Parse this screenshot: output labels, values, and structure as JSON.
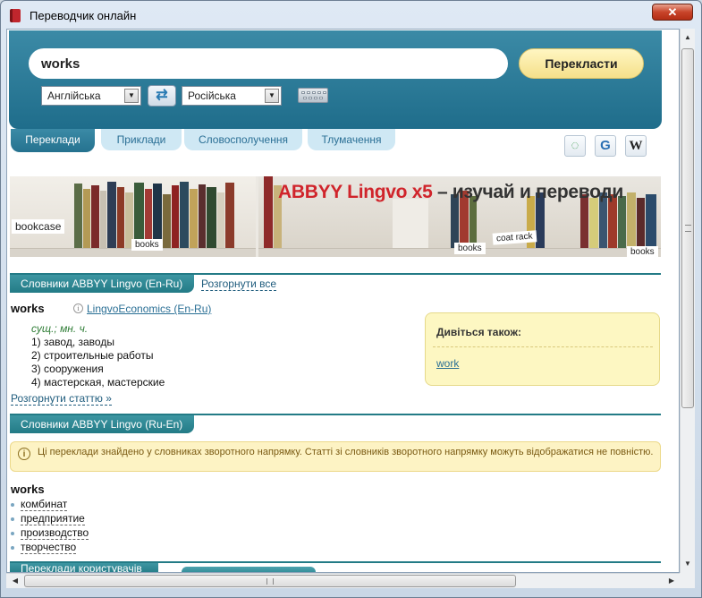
{
  "window": {
    "title": "Переводчик онлайн",
    "close_label": "✕"
  },
  "search": {
    "query": "works",
    "translate_label": "Перекласти",
    "source_lang": "Англійська",
    "target_lang": "Російська"
  },
  "tabs": [
    {
      "label": "Переклади"
    },
    {
      "label": "Приклади"
    },
    {
      "label": "Словосполучення"
    },
    {
      "label": "Тлумачення"
    }
  ],
  "side_icons": [
    "speech-bubble-icon",
    "google-icon",
    "wikipedia-icon"
  ],
  "side_icon_glyphs": {
    "google": "G",
    "wikipedia": "W"
  },
  "banner": {
    "brand": "ABBYY Lingvo x5",
    "tagline": " – изучай и переводи",
    "labels": [
      "bookcase",
      "books",
      "coat rack",
      "books",
      "books"
    ]
  },
  "section1": {
    "title": "Словники ABBYY Lingvo (En-Ru)",
    "expand_all": "Розгорнути все",
    "headword": "works",
    "dict_link": "LingvoEconomics (En-Ru)",
    "grammar": "сущ.; мн. ч.",
    "meanings": [
      "1) завод, заводы",
      "2) строительные работы",
      "3) сооружения",
      "4) мастерская, мастерские"
    ],
    "expand_article": "Розгорнути статтю »"
  },
  "see_also": {
    "title": "Дивіться також:",
    "link": "work"
  },
  "section2": {
    "title": "Словники ABBYY Lingvo (Ru-En)",
    "notice": "Ці переклади знайдено у словниках зворотного напрямку. Статті зі словників зворотного напрямку можуть відображатися не повністю.",
    "headword": "works",
    "items": [
      "комбинат",
      "предприятие",
      "производство",
      "творчество"
    ]
  },
  "section3": {
    "title": "Переклади користувачів"
  },
  "colors": {
    "accent": "#237b86",
    "panel": "#2a7c99",
    "button": "#f5e08a",
    "tab_inactive": "#cfe8f4"
  }
}
